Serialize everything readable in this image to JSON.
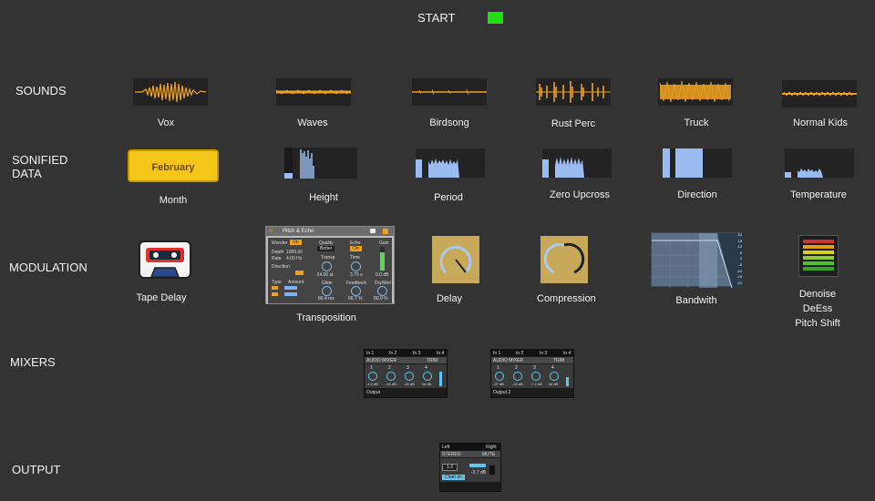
{
  "start": {
    "label": "START",
    "indicator_color": "#22dd11"
  },
  "rows": {
    "sounds": "SOUNDS",
    "sonified_data": "SONIFIED\nDATA",
    "modulation": "MODULATION",
    "mixers": "MIXERS",
    "output": "OUTPUT"
  },
  "sounds": [
    {
      "label": "Vox"
    },
    {
      "label": "Waves"
    },
    {
      "label": "Birdsong"
    },
    {
      "label": "Rust Perc"
    },
    {
      "label": "Truck"
    },
    {
      "label": "Normal Kids"
    }
  ],
  "sonified": {
    "month_button": "February",
    "month_label": "Month",
    "items": [
      {
        "label": "Height"
      },
      {
        "label": "Period"
      },
      {
        "label": "Zero Upcross"
      },
      {
        "label": "Direction"
      },
      {
        "label": "Temperature"
      }
    ]
  },
  "modulation": {
    "tape_delay": "Tape Delay",
    "transposition": "Transposition",
    "delay": "Delay",
    "compression": "Compression",
    "bandwidth": "Bandwith",
    "denoise": "Denoise",
    "deess": "DeEss",
    "pitch_shift": "Pitch Shift",
    "pitch_echo": {
      "title": "Pitch & Echo",
      "wonder": "Wonder",
      "wonder_val": "On",
      "depth": "Depth",
      "depth_val": "1000.00",
      "rate": "Rate",
      "rate_val": "4.00 Hz",
      "direction": "Direction",
      "type": "Type",
      "amount": "Amount",
      "quality": "Quality",
      "quality_val": "Better",
      "transp": "Transp",
      "transp_val": "-24.00 st",
      "glide": "Glide",
      "glide_val": "80.4 ms",
      "echo": "Echo",
      "echo_val": "On",
      "time": "Time",
      "time_val": "3.75 s",
      "feedback": "Feedback",
      "feedback_val": "66.7 %",
      "gain": "Gain",
      "gain_val": "0.0 dB",
      "drywet": "Dry/Wet",
      "drywet_val": "80.0 %"
    },
    "bandwidth_scale": [
      "24",
      "18",
      "12",
      "6",
      "0",
      "-6",
      "-12",
      "-18",
      "-24"
    ]
  },
  "mixers": [
    {
      "tracks": [
        "In 1",
        "In 2",
        "In 3",
        "In 4"
      ],
      "title": "AUDIO MIXER",
      "mode": "TRIM",
      "channels": [
        "1",
        "2",
        "3",
        "4"
      ],
      "values": [
        "-1.2 dB",
        "-14 dB",
        "-30 dB",
        "inf dB"
      ],
      "output": "Output"
    },
    {
      "tracks": [
        "In 1",
        "In 2",
        "In 3",
        "In 4"
      ],
      "title": "AUDIO MIXER",
      "mode": "TRIM",
      "channels": [
        "1",
        "2",
        "3",
        "4"
      ],
      "values": [
        "-27 dB",
        "-24 dB",
        "-7.2 dB",
        "inf dB"
      ],
      "output": "Output 2"
    }
  ],
  "output": {
    "left": "Left",
    "right": "Right",
    "title": "STEREO",
    "mode": "MUTE",
    "channel": "1-2",
    "value": "-3.7 dB",
    "button": "Chan on"
  }
}
